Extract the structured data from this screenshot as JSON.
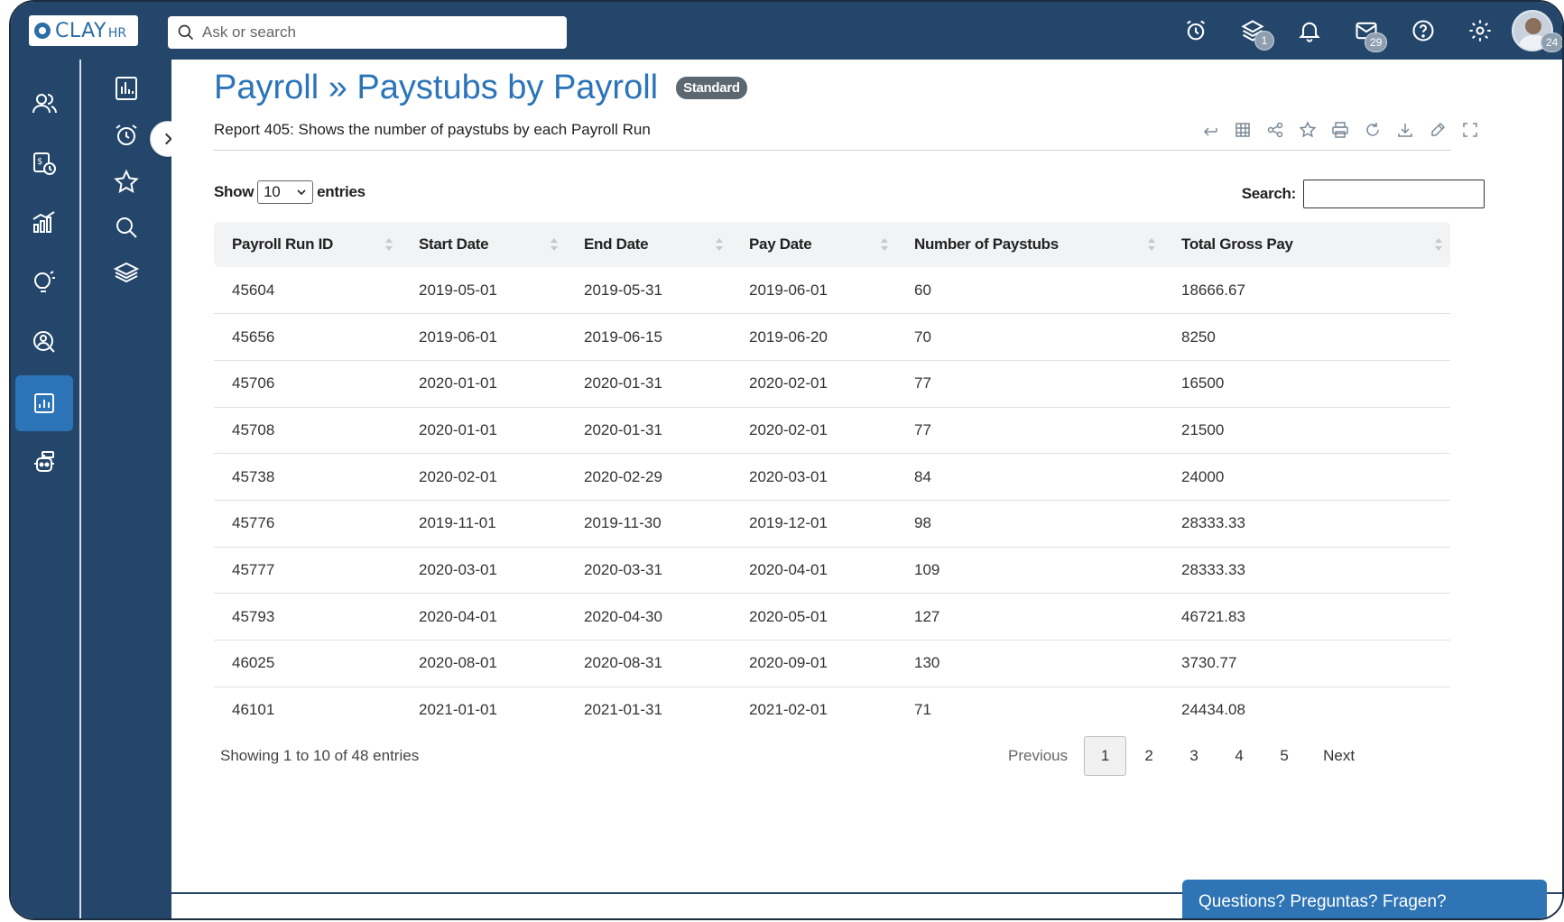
{
  "app": {
    "logo_text": "CLAY",
    "logo_sub": "HR",
    "brand_color": "#23466a",
    "accent_color": "#2b74b8"
  },
  "topbar": {
    "search_placeholder": "Ask or search",
    "icons": [
      {
        "name": "alarm-icon",
        "badge": ""
      },
      {
        "name": "layers-icon",
        "badge": "1"
      },
      {
        "name": "bell-icon",
        "badge": ""
      },
      {
        "name": "mail-icon",
        "badge": "29"
      },
      {
        "name": "help-icon",
        "badge": ""
      },
      {
        "name": "settings-icon",
        "badge": ""
      }
    ],
    "avatar_badge": "24"
  },
  "rail1": {
    "items": [
      "people-icon",
      "payroll-clock-icon",
      "analytics-icon",
      "ideas-icon",
      "people-search-icon",
      "reports-icon",
      "bot-icon"
    ],
    "active": "reports-icon"
  },
  "rail2": {
    "items": [
      "bar-chart-icon",
      "alarm-icon",
      "star-icon",
      "search-icon",
      "layers-icon"
    ]
  },
  "page": {
    "title": "Payroll » Paystubs by Payroll",
    "badge": "Standard",
    "description": "Report 405: Shows the number of paystubs by each Payroll Run"
  },
  "toolbar": [
    "back-icon",
    "grid-icon",
    "share-icon",
    "star-icon",
    "print-icon",
    "refresh-icon",
    "download-icon",
    "edit-icon",
    "fullscreen-icon"
  ],
  "controls": {
    "show_label": "Show",
    "show_value": "10",
    "entries_label": "entries",
    "search_label": "Search:",
    "search_value": ""
  },
  "table": {
    "columns": [
      "Payroll Run ID",
      "Start Date",
      "End Date",
      "Pay Date",
      "Number of Paystubs",
      "Total Gross Pay"
    ],
    "rows": [
      [
        "45604",
        "2019-05-01",
        "2019-05-31",
        "2019-06-01",
        "60",
        "18666.67"
      ],
      [
        "45656",
        "2019-06-01",
        "2019-06-15",
        "2019-06-20",
        "70",
        "8250"
      ],
      [
        "45706",
        "2020-01-01",
        "2020-01-31",
        "2020-02-01",
        "77",
        "16500"
      ],
      [
        "45708",
        "2020-01-01",
        "2020-01-31",
        "2020-02-01",
        "77",
        "21500"
      ],
      [
        "45738",
        "2020-02-01",
        "2020-02-29",
        "2020-03-01",
        "84",
        "24000"
      ],
      [
        "45776",
        "2019-11-01",
        "2019-11-30",
        "2019-12-01",
        "98",
        "28333.33"
      ],
      [
        "45777",
        "2020-03-01",
        "2020-03-31",
        "2020-04-01",
        "109",
        "28333.33"
      ],
      [
        "45793",
        "2020-04-01",
        "2020-04-30",
        "2020-05-01",
        "127",
        "46721.83"
      ],
      [
        "46025",
        "2020-08-01",
        "2020-08-31",
        "2020-09-01",
        "130",
        "3730.77"
      ],
      [
        "46101",
        "2021-01-01",
        "2021-01-31",
        "2021-02-01",
        "71",
        "24434.08"
      ]
    ]
  },
  "footer": {
    "info": "Showing 1 to 10 of 48 entries",
    "previous": "Previous",
    "pages": [
      "1",
      "2",
      "3",
      "4",
      "5"
    ],
    "current_page": "1",
    "next": "Next"
  },
  "help": {
    "label": "Questions? Preguntas? Fragen?"
  }
}
